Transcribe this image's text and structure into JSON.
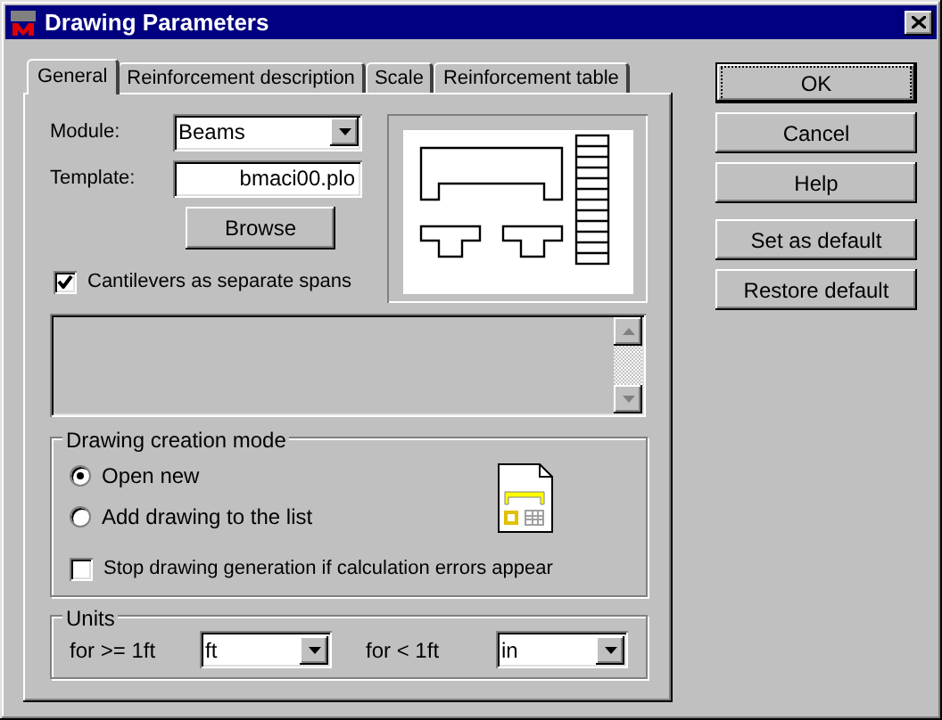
{
  "window": {
    "title": "Drawing Parameters"
  },
  "tabs": [
    {
      "label": "General",
      "selected": true
    },
    {
      "label": "Reinforcement description",
      "selected": false
    },
    {
      "label": "Scale",
      "selected": false
    },
    {
      "label": "Reinforcement table",
      "selected": false
    }
  ],
  "module": {
    "label": "Module:",
    "value": "Beams"
  },
  "template": {
    "label": "Template:",
    "value": "bmaci00.plo"
  },
  "browse_button": "Browse",
  "cantilevers": {
    "label": "Cantilevers as separate spans",
    "checked": true
  },
  "drawing_creation_mode": {
    "title": "Drawing creation mode",
    "options": [
      {
        "label": "Open new",
        "selected": true
      },
      {
        "label": "Add drawing to the list",
        "selected": false
      }
    ],
    "stop_on_errors": {
      "label": "Stop drawing generation if calculation errors appear",
      "checked": false
    }
  },
  "units": {
    "title": "Units",
    "fields": [
      {
        "label": "for >= 1ft",
        "value": "ft"
      },
      {
        "label": "for < 1ft",
        "value": "in"
      }
    ]
  },
  "buttons": [
    {
      "label": "OK",
      "focused": true
    },
    {
      "label": "Cancel",
      "focused": false
    },
    {
      "label": "Help",
      "focused": false
    },
    {
      "label": "Set as default",
      "focused": false
    },
    {
      "label": "Restore default",
      "focused": false
    }
  ]
}
